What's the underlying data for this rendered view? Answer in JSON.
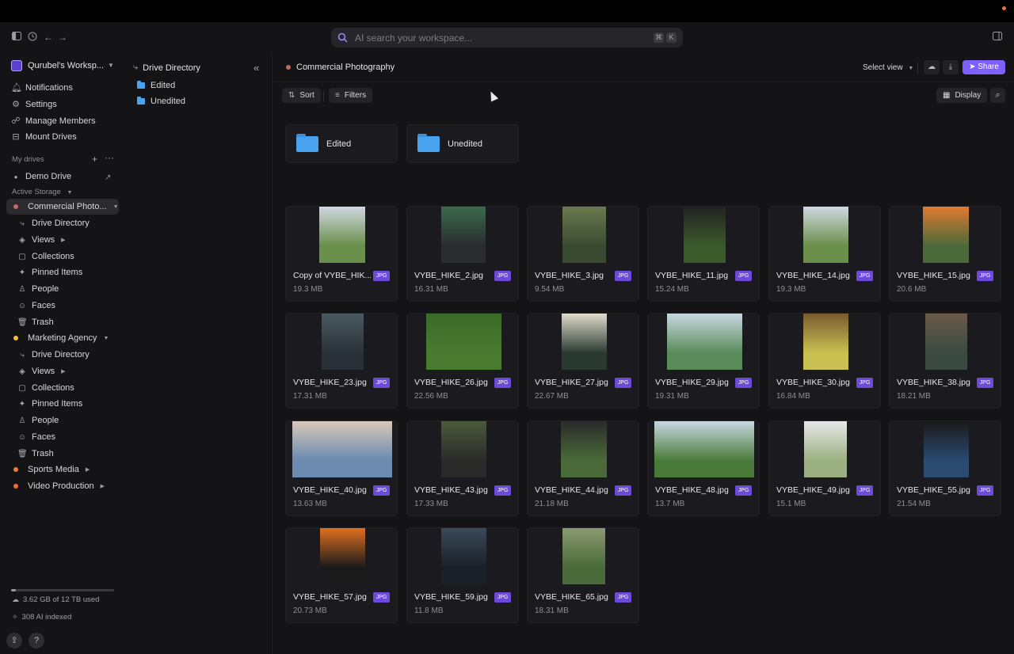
{
  "toolbar": {
    "search_placeholder": "AI search your workspace...",
    "shortcut_keys": [
      "⌘",
      "K"
    ]
  },
  "sidebar": {
    "workspace_name": "Qurubel's Worksp...",
    "nav": [
      {
        "label": "Notifications",
        "icon": "bell-icon"
      },
      {
        "label": "Settings",
        "icon": "gear-icon"
      },
      {
        "label": "Manage Members",
        "icon": "users-icon"
      },
      {
        "label": "Mount Drives",
        "icon": "drive-icon"
      }
    ],
    "my_drives_label": "My drives",
    "demo_drive_label": "Demo Drive",
    "active_storage_label": "Active Storage",
    "drives": [
      {
        "label": "Commercial Photo...",
        "color": "#c06a64"
      },
      {
        "label": "Marketing Agency",
        "color": "#f0c040"
      },
      {
        "label": "Sports Media",
        "color": "#f07a30"
      },
      {
        "label": "Video Production",
        "color": "#f06a40"
      }
    ],
    "drive_subitems": [
      "Drive Directory",
      "Views",
      "Collections",
      "Pinned Items",
      "People",
      "Faces",
      "Trash"
    ],
    "storage_text": "3.62 GB of 12 TB used",
    "storage_fraction": 0.0003,
    "ai_indexed_text": "308 AI indexed",
    "help_label": "?"
  },
  "directory": {
    "title": "Drive Directory",
    "items": [
      "Edited",
      "Unedited"
    ]
  },
  "main": {
    "breadcrumb": "Commercial Photography",
    "select_view": "Select view",
    "share_label": "Share",
    "sort_label": "Sort",
    "filters_label": "Filters",
    "display_label": "Display",
    "folders": [
      "Edited",
      "Unedited"
    ],
    "files": [
      {
        "name": "Copy of VYBE_HIK...",
        "size": "19.3 MB",
        "type": "JPG"
      },
      {
        "name": "VYBE_HIKE_2.jpg",
        "size": "16.31 MB",
        "type": "JPG"
      },
      {
        "name": "VYBE_HIKE_3.jpg",
        "size": "9.54 MB",
        "type": "JPG"
      },
      {
        "name": "VYBE_HIKE_11.jpg",
        "size": "15.24 MB",
        "type": "JPG"
      },
      {
        "name": "VYBE_HIKE_14.jpg",
        "size": "19.3 MB",
        "type": "JPG"
      },
      {
        "name": "VYBE_HIKE_15.jpg",
        "size": "20.6 MB",
        "type": "JPG"
      },
      {
        "name": "VYBE_HIKE_23.jpg",
        "size": "17.31 MB",
        "type": "JPG"
      },
      {
        "name": "VYBE_HIKE_26.jpg",
        "size": "22.56 MB",
        "type": "JPG"
      },
      {
        "name": "VYBE_HIKE_27.jpg",
        "size": "22.67 MB",
        "type": "JPG"
      },
      {
        "name": "VYBE_HIKE_29.jpg",
        "size": "19.31 MB",
        "type": "JPG"
      },
      {
        "name": "VYBE_HIKE_30.jpg",
        "size": "16.84 MB",
        "type": "JPG"
      },
      {
        "name": "VYBE_HIKE_38.jpg",
        "size": "18.21 MB",
        "type": "JPG"
      },
      {
        "name": "VYBE_HIKE_40.jpg",
        "size": "13.63 MB",
        "type": "JPG"
      },
      {
        "name": "VYBE_HIKE_43.jpg",
        "size": "17.33 MB",
        "type": "JPG"
      },
      {
        "name": "VYBE_HIKE_44.jpg",
        "size": "21.18 MB",
        "type": "JPG"
      },
      {
        "name": "VYBE_HIKE_48.jpg",
        "size": "13.7 MB",
        "type": "JPG"
      },
      {
        "name": "VYBE_HIKE_49.jpg",
        "size": "15.1 MB",
        "type": "JPG"
      },
      {
        "name": "VYBE_HIKE_55.jpg",
        "size": "21.54 MB",
        "type": "JPG"
      },
      {
        "name": "VYBE_HIKE_57.jpg",
        "size": "20.73 MB",
        "type": "JPG"
      },
      {
        "name": "VYBE_HIKE_59.jpg",
        "size": "11.8 MB",
        "type": "JPG"
      },
      {
        "name": "VYBE_HIKE_65.jpg",
        "size": "18.31 MB",
        "type": "JPG"
      }
    ]
  },
  "colors": {
    "accent": "#7e5fff",
    "folder": "#49a2ee",
    "badge": "#6b4bd8"
  }
}
